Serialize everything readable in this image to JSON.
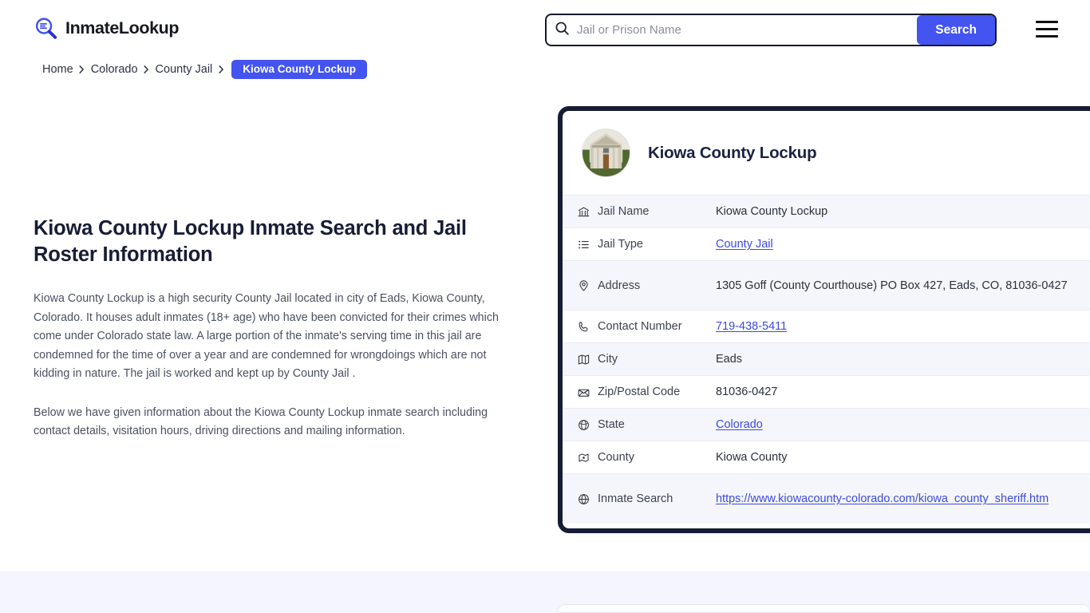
{
  "header": {
    "brand_name": "InmateLookup",
    "brand_icon": "magnifier-logo-icon",
    "search": {
      "placeholder": "Jail or Prison Name",
      "value": "",
      "icon": "search-icon",
      "button_label": "Search"
    },
    "menu_icon": "hamburger-menu-icon"
  },
  "breadcrumb": {
    "items": [
      {
        "label": "Home",
        "current": false
      },
      {
        "label": "Colorado",
        "current": false
      },
      {
        "label": "County Jail",
        "current": false
      }
    ],
    "current": "Kiowa County Lockup",
    "separator": "›"
  },
  "main": {
    "page_title": "Kiowa County Lockup Inmate Search and Jail Roster Information",
    "paragraph_1": "Kiowa County Lockup is a high security County Jail located in city of Eads, Kiowa County, Colorado. It houses adult inmates (18+ age) who have been convicted for their crimes which come under Colorado state law. A large portion of the inmate's serving time in this jail are condemned for the time of over a year and are condemned for wrongdoings which are not kidding in nature. The jail is worked and kept up by County Jail .",
    "paragraph_2": "Below we have given information about the Kiowa County Lockup inmate search including contact details, visitation hours, driving directions and mailing information."
  },
  "card": {
    "avatar_icon": "courthouse-photo",
    "title": "Kiowa County Lockup",
    "rows": [
      {
        "icon": "bank-icon",
        "label": "Jail Name",
        "value": "Kiowa County Lockup",
        "link": false
      },
      {
        "icon": "list-icon",
        "label": "Jail Type",
        "value": "County Jail",
        "link": true
      },
      {
        "icon": "location-pin-icon",
        "label": "Address",
        "value": "1305 Goff (County Courthouse) PO Box 427, Eads, CO, 81036-0427",
        "link": false
      },
      {
        "icon": "phone-icon",
        "label": "Contact Number",
        "value": "719-438-5411",
        "link": true
      },
      {
        "icon": "map-icon",
        "label": "City",
        "value": "Eads",
        "link": false
      },
      {
        "icon": "envelope-icon",
        "label": "Zip/Postal Code",
        "value": "81036-0427",
        "link": false
      },
      {
        "icon": "globe-state-icon",
        "label": "State",
        "value": "Colorado",
        "link": true
      },
      {
        "icon": "county-icon",
        "label": "County",
        "value": "Kiowa County",
        "link": false
      },
      {
        "icon": "web-globe-icon",
        "label": "Inmate Search",
        "value": "https://www.kiowacounty-colorado.com/kiowa_county_sheriff.htm",
        "link": true
      }
    ]
  },
  "colors": {
    "accent": "#4354f0",
    "link": "#3b4ae3",
    "card_border": "#161c33",
    "row_alt": "#f5f6fb",
    "band": "#f5f5fd",
    "heading": "#181d35"
  }
}
